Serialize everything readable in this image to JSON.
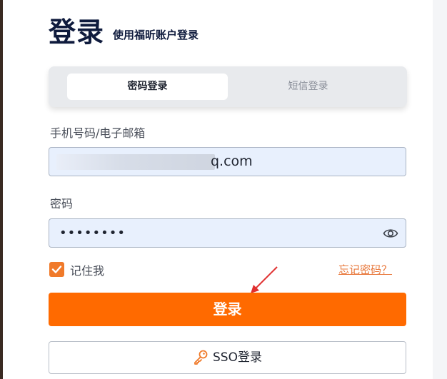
{
  "header": {
    "title": "登录",
    "subtitle": "使用福昕账户登录"
  },
  "tabs": [
    {
      "label": "密码登录",
      "active": true
    },
    {
      "label": "短信登录",
      "active": false
    }
  ],
  "form": {
    "account_label": "手机号码/电子邮箱",
    "account_value_visible": "q.com",
    "password_label": "密码",
    "password_value": "••••••••"
  },
  "options": {
    "remember_label": "记住我",
    "remember_checked": true,
    "forgot_label": "忘记密码？"
  },
  "buttons": {
    "login_label": "登录",
    "sso_label": "SSO登录"
  },
  "colors": {
    "accent": "#ff6a00",
    "link": "#e8773a",
    "title": "#0f1b3d",
    "input_bg": "#e8f0fd"
  },
  "icons": {
    "password_toggle": "eye-icon",
    "sso": "key-icon",
    "checkbox": "check-icon",
    "annotation": "arrow-icon"
  }
}
